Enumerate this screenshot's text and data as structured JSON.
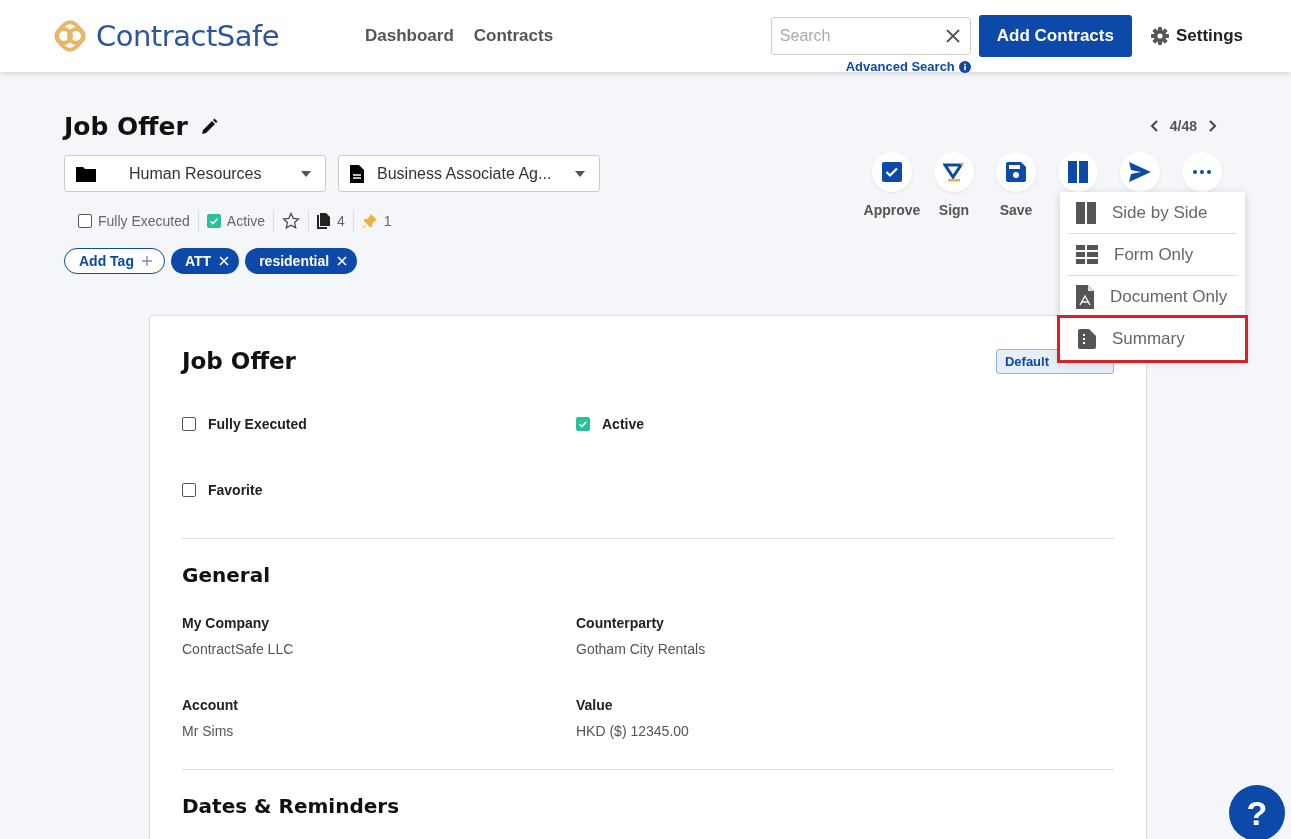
{
  "logo": {
    "text": "ContractSafe"
  },
  "nav": [
    {
      "label": "Dashboard"
    },
    {
      "label": "Contracts"
    }
  ],
  "search": {
    "placeholder": "Search",
    "advanced_link": "Advanced Search"
  },
  "add_button": "Add Contracts",
  "settings": "Settings",
  "title": "Job Offer",
  "pager": "4/48",
  "selects": [
    {
      "kind": "folder",
      "value": "Human Resources"
    },
    {
      "kind": "document",
      "value": "Business Associate Ag..."
    }
  ],
  "status": {
    "fully_executed": {
      "label": "Fully Executed",
      "checked": false
    },
    "active": {
      "label": "Active",
      "checked": true
    },
    "favorite": false,
    "attachments": "4",
    "pins": "1"
  },
  "tags": {
    "add_label": "Add Tag",
    "items": [
      {
        "label": "ATT"
      },
      {
        "label": "residential"
      }
    ]
  },
  "actions": [
    {
      "kind": "approve",
      "label": "Approve"
    },
    {
      "kind": "sign",
      "label": "Sign"
    },
    {
      "kind": "save",
      "label": "Save"
    },
    {
      "kind": "layout"
    },
    {
      "kind": "send"
    },
    {
      "kind": "more"
    }
  ],
  "view_menu": [
    {
      "kind": "side",
      "label": "Side by Side",
      "highlighted": false
    },
    {
      "kind": "form",
      "label": "Form Only",
      "highlighted": false
    },
    {
      "kind": "document",
      "label": "Document Only",
      "highlighted": false
    },
    {
      "kind": "summary",
      "label": "Summary",
      "highlighted": true
    }
  ],
  "form": {
    "title": "Job Offer",
    "badge": "Default",
    "checkboxes": [
      {
        "label": "Fully Executed",
        "checked": false
      },
      {
        "label": "Active",
        "checked": true
      },
      {
        "label": "Favorite",
        "checked": false
      }
    ],
    "sections": [
      {
        "title": "General",
        "fields": [
          {
            "label": "My Company",
            "value": "ContractSafe LLC"
          },
          {
            "label": "Counterparty",
            "value": "Gotham City Rentals"
          },
          {
            "label": "Account",
            "value": "Mr Sims"
          },
          {
            "label": "Value",
            "value": "HKD ($) 12345.00"
          }
        ]
      },
      {
        "title": "Dates & Reminders"
      }
    ]
  },
  "help": "?"
}
